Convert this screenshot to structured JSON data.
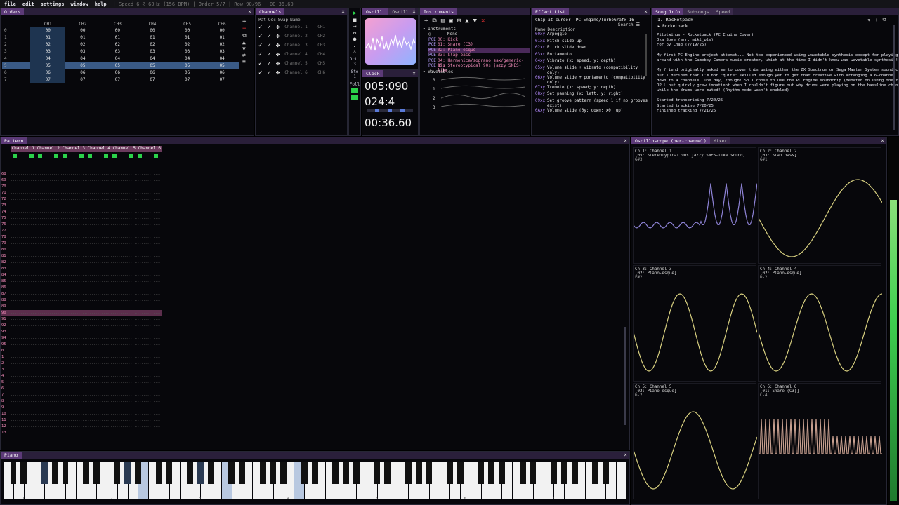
{
  "menubar": {
    "items": [
      "file",
      "edit",
      "settings",
      "window",
      "help"
    ],
    "status": "| Speed 6 @ 60Hz (156 BPM) | Order 5/7 | Row 90/96 | 00:36.60"
  },
  "orders": {
    "tab": "Orders",
    "headers": [
      "CH1",
      "CH2",
      "CH3",
      "CH4",
      "CH5",
      "CH6"
    ],
    "rows": [
      [
        "00",
        "00",
        "00",
        "00",
        "00",
        "00"
      ],
      [
        "01",
        "01",
        "01",
        "01",
        "01",
        "01"
      ],
      [
        "02",
        "02",
        "02",
        "02",
        "02",
        "02"
      ],
      [
        "03",
        "03",
        "03",
        "03",
        "03",
        "03"
      ],
      [
        "04",
        "04",
        "04",
        "04",
        "04",
        "04"
      ],
      [
        "05",
        "05",
        "05",
        "05",
        "05",
        "05"
      ],
      [
        "06",
        "06",
        "06",
        "06",
        "06",
        "06"
      ],
      [
        "07",
        "07",
        "07",
        "07",
        "07",
        "07"
      ]
    ],
    "row_labels": [
      "0",
      "1",
      "2",
      "3",
      "4",
      "5",
      "6",
      "7"
    ],
    "selected_row": 5
  },
  "channels": {
    "tab": "Channels",
    "headers": [
      "Pat",
      "Osc",
      "Swap",
      "Name"
    ],
    "rows": [
      {
        "name": "Channel 1",
        "short": "CH1"
      },
      {
        "name": "Channel 2",
        "short": "CH2"
      },
      {
        "name": "Channel 3",
        "short": "CH3"
      },
      {
        "name": "Channel 4",
        "short": "CH4"
      },
      {
        "name": "Channel 5",
        "short": "CH5"
      },
      {
        "name": "Channel 6",
        "short": "CH6"
      }
    ]
  },
  "osc_tabs": [
    "Oscill.",
    "Oscill."
  ],
  "clock": {
    "tab": "Clock",
    "side_labels": [
      "Ste",
      "1",
      "Foll",
      "Oct.",
      "3"
    ],
    "values": [
      "005:090",
      "024:4",
      "00:36.60"
    ]
  },
  "instruments": {
    "tab": "Instruments",
    "tree_label": "Instruments",
    "items": [
      {
        "tag": "",
        "label": "- None -"
      },
      {
        "tag": "PCE",
        "label": "00: Kick"
      },
      {
        "tag": "PCE",
        "label": "01: Snare (C3)"
      },
      {
        "tag": "PCE",
        "label": "02: Piano-esque"
      },
      {
        "tag": "PCE",
        "label": "03: Slap bass"
      },
      {
        "tag": "PCE",
        "label": "04: Harmonica/soprano sax/generic-ass"
      },
      {
        "tag": "PCE",
        "label": "05: Stereotypical 90s jazzy SNES-like"
      }
    ],
    "wavetables_label": "Wavetables",
    "wave_indices": [
      "0",
      "1",
      "2",
      "3"
    ]
  },
  "effects": {
    "tab": "Effect List",
    "chip": "Chip at cursor: PC Engine/TurboGrafx-16",
    "search": "Search",
    "headers": [
      "Name",
      "Description"
    ],
    "items": [
      {
        "code": "00xy",
        "desc": "Arpeggio"
      },
      {
        "code": "01xx",
        "desc": "Pitch slide up"
      },
      {
        "code": "02xx",
        "desc": "Pitch slide down"
      },
      {
        "code": "03xx",
        "desc": "Portamento"
      },
      {
        "code": "04xy",
        "desc": "Vibrato (x: speed; y: depth)"
      },
      {
        "code": "05xy",
        "desc": "Volume slide + vibrato (compatibility only)"
      },
      {
        "code": "06xy",
        "desc": "Volume slide + portamento (compatibility only)"
      },
      {
        "code": "07xy",
        "desc": "Tremolo (x: speed; y: depth)"
      },
      {
        "code": "08xy",
        "desc": "Set panning (x: left; y: right)"
      },
      {
        "code": "09xx",
        "desc": "Set groove pattern (speed 1 if no grooves exist)"
      },
      {
        "code": "0Axy",
        "desc": "Volume slide (0y: down; x0: up)"
      }
    ]
  },
  "song_info": {
    "tabs": [
      "Song Info",
      "Subsongs",
      "Speed"
    ],
    "subsong": "1. Rocketpack",
    "title": "Rocketpack",
    "lines": [
      "Pilotwings - Rocketpack (PC Engine Cover)",
      "Oka Soye (arr. mikl_pls)",
      "For by Chad (7/19/25)",
      "",
      "My first PC Engine project attempt... Not too experienced using wavetable synthesis except for playing",
      "around with the Gameboy Camera music creator, which at the time I didn't know was wavetable synthesis!",
      "",
      "My friend originally asked me to cover this using either the ZX Spectrum or Sega Master System sound chips,",
      "but I decided that I'm not \"quite\" skilled enough yet to get that creative with arranging a 6-channel song",
      "down to 4 channels. One day, though! So I chose to use the PC Engine soundchip (debated on using the YM2413",
      "OPLL but quickly grew impatient when I couldn't figure out why drums were playing on the bassline channel",
      "while the drums were muted! (Rhythm mode wasn't enabled)",
      "",
      "Started transcribing 7/20/25",
      "Started tracking 7/20/25",
      "Finished tracking 7/21/25"
    ]
  },
  "pattern": {
    "tab": "Pattern",
    "channels": [
      "Channel 1",
      "Channel 2",
      "Channel 3",
      "Channel 4",
      "Channel 5",
      "Channel 6"
    ],
    "row_numbers": [
      "68",
      "69",
      "70",
      "71",
      "72",
      "73",
      "74",
      "75",
      "76",
      "77",
      "78",
      "79",
      "80",
      "81",
      "82",
      "83",
      "84",
      "85",
      "86",
      "87",
      "88",
      "89",
      "90",
      "91",
      "92",
      "93",
      "94",
      "95",
      "0",
      "1",
      "2",
      "3",
      "4",
      "5",
      "6",
      "7",
      "8",
      "9",
      "10",
      "11",
      "12",
      "13"
    ],
    "current_row": "90"
  },
  "oscilloscope": {
    "tabs": [
      "Oscilloscope (per-channel)",
      "Mixer"
    ],
    "channels": [
      {
        "title": "Ch 1: Channel 1",
        "inst": "[05: Stereotypical 90s jazzy SNES-like sound]",
        "note": "G#3"
      },
      {
        "title": "Ch 2: Channel 2",
        "inst": "[03: Slap bass]",
        "note": "G#1"
      },
      {
        "title": "Ch 3: Channel 3",
        "inst": "[02: Piano-esque]",
        "note": "F#2"
      },
      {
        "title": "Ch 4: Channel 4",
        "inst": "[02: Piano-esque]",
        "note": "D-2"
      },
      {
        "title": "Ch 5: Channel 5",
        "inst": "[02: Piano-esque]",
        "note": "G-2"
      },
      {
        "title": "Ch 6: Channel 6",
        "inst": "[01: Snare (C3)]",
        "note": "C-4"
      }
    ]
  },
  "piano": {
    "tab": "Piano",
    "octave_labels": [
      "1",
      "2",
      "3",
      "4",
      "5",
      "6",
      "7"
    ]
  },
  "colors": {
    "accent": "#5c3a78",
    "tab_bar": "#2a1f3a",
    "ch1_wave": "#8f84d8",
    "wave": "#d8d080",
    "snare_wave": "#c8a090",
    "pattern_note_pink": "#f08ab8",
    "active_green": "#2bd14a",
    "meter_green": "#3fcf4f"
  }
}
